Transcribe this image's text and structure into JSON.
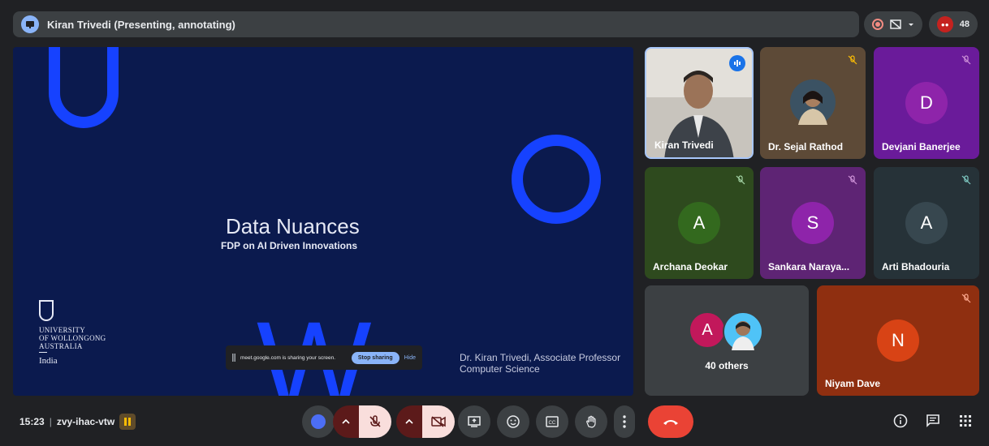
{
  "header": {
    "presenter_title": "Kiran Trivedi (Presenting, annotating)",
    "participant_count": "48"
  },
  "slide": {
    "title": "Data Nuances",
    "subtitle": "FDP on AI Driven Innovations",
    "university_lines": [
      "UNIVERSITY",
      "OF WOLLONGONG",
      "AUSTRALIA"
    ],
    "university_region": "India",
    "presenter_line1": "Dr. Kiran Trivedi, Associate Professor",
    "presenter_line2": "Computer Science",
    "decor_letters": {
      "u": "U",
      "o": "O",
      "w": "W"
    }
  },
  "share_bar": {
    "message": "meet.google.com is sharing your screen.",
    "stop_label": "Stop sharing",
    "hide_label": "Hide"
  },
  "participants": [
    {
      "name": "Kiran Trivedi",
      "type": "video",
      "speaking": true
    },
    {
      "name": "Dr. Sejal Rathod",
      "type": "photo",
      "muted": true
    },
    {
      "name": "Devjani Banerjee",
      "initial": "D",
      "color": "#7b1fa2",
      "muted": true
    },
    {
      "name": "Archana Deokar",
      "initial": "A",
      "color": "#33691e",
      "muted": true
    },
    {
      "name": "Sankara Naraya...",
      "initial": "S",
      "color": "#8e24aa",
      "muted": true
    },
    {
      "name": "Arti Bhadouria",
      "initial": "A",
      "color": "#37474f",
      "muted": true
    },
    {
      "name": "40 others",
      "initial": "A",
      "color": "#c2185b"
    },
    {
      "name": "Niyam Dave",
      "initial": "N",
      "color": "#d84315",
      "muted": true
    }
  ],
  "meeting": {
    "time": "15:23",
    "code": "zvy-ihac-vtw"
  },
  "colors": {
    "slide_bg": "#0b1a4e",
    "accent_blue": "#1642ff",
    "end_call": "#ea4335"
  }
}
